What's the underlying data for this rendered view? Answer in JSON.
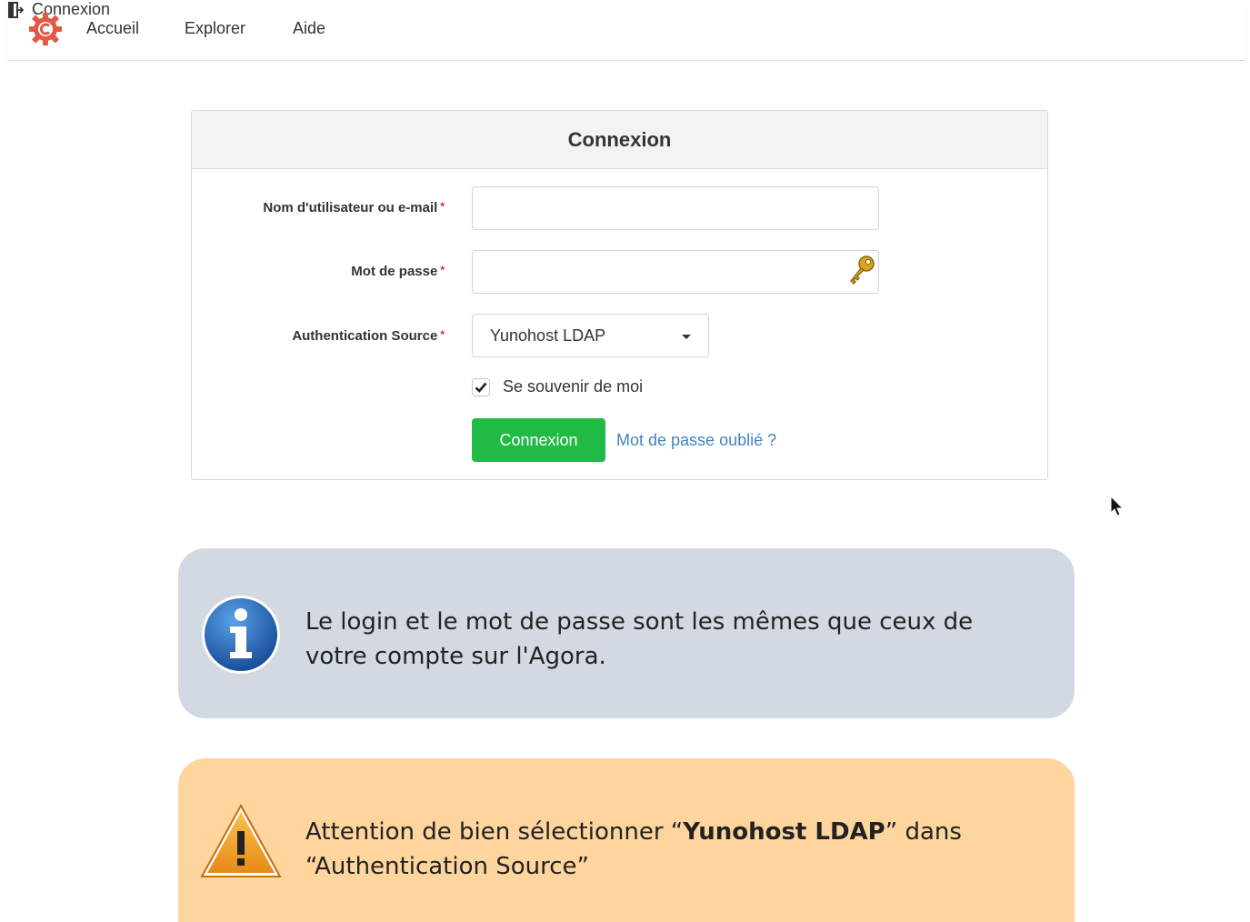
{
  "nav": {
    "home_label": "Accueil",
    "explore_label": "Explorer",
    "help_label": "Aide",
    "login_label": "Connexion"
  },
  "login_panel": {
    "title": "Connexion",
    "username_label": "Nom d'utilisateur ou e-mail",
    "username_value": "",
    "password_label": "Mot de passe",
    "password_value": "",
    "auth_source_label": "Authentication Source",
    "auth_source_value": "Yunohost LDAP",
    "required_mark": "*",
    "remember_label": "Se souvenir de moi",
    "remember_checked": true,
    "submit_label": "Connexion",
    "forgot_label": "Mot de passe oublié ?"
  },
  "info_note": {
    "text": "Le login et le mot de passe sont les mêmes que ceux de votre compte sur l'Agora."
  },
  "warning_note": {
    "text_before": "Attention de bien sélectionner “",
    "text_bold": "Yunohost LDAP",
    "text_after": "” dans “Authentication Source”"
  },
  "colors": {
    "brand": "#e05a47",
    "button_green": "#21ba45",
    "link_blue": "#4183c4",
    "info_bg": "#d3d9e2",
    "warning_bg": "#ffd59e",
    "required_red": "#db2828"
  },
  "icons": {
    "logo": "gitea-gear-logo",
    "login": "door-exit-icon",
    "password": "key-icon",
    "info": "info-icon",
    "warning": "warning-triangle-icon",
    "check": "check-icon",
    "caret": "caret-down-icon"
  }
}
